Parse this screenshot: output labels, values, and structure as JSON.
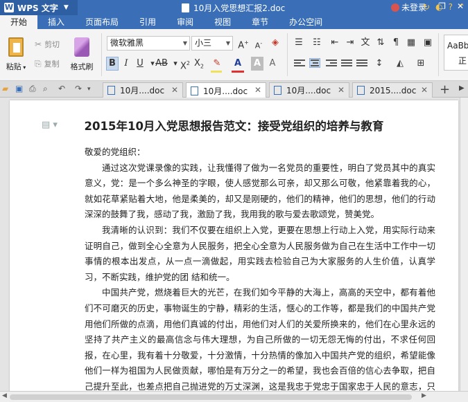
{
  "app": {
    "name": "WPS 文字",
    "doc_title": "10月入党思想汇报2.doc",
    "login_label": "未登录"
  },
  "menu": [
    "开始",
    "插入",
    "页面布局",
    "引用",
    "审阅",
    "视图",
    "章节",
    "办公空间"
  ],
  "ribbon": {
    "paste": "粘贴",
    "cut": "剪切",
    "copy": "复制",
    "format_painter": "格式刷",
    "font_name": "微软雅黑",
    "font_size": "小三",
    "style_preview_top": "AaBb",
    "style_preview_bottom": "正"
  },
  "tabs": [
    "10月....doc",
    "10月....doc",
    "10月....doc",
    "2015....doc"
  ],
  "document": {
    "heading": "2015年10月入党思想报告范文：接受党组织的培养与教育",
    "salutation": "敬爱的党组织：",
    "paragraphs": [
      "通过这次党课录像的实践，让我懂得了做为一名党员的重要性，明白了党员其中的真实意义，党：是一个多么神圣的字眼，使人感觉那么可亲，却又那么可敬，他紧靠着我的心，就如花草紧贴着大地，他是柔美的，却又是刚硬的，他们的精神，他们的思想，他们的行动深深的鼓舞了我，感动了我，激励了我，我用我的歌与爱去歌颂党，赞美党。",
      "我清晰的认识到：我们不仅要在组织上入党，更要在思想上行动上入党，用实际行动来证明自己，做到全心全意为人民服务，把全心全意为人民服务做为自己在生活中工作中一切事情的根本出发点，从一点一滴做起，用实践去检验自己为大家服务的人生价值，认真学习，不断实践，维护党的团 结和统一。",
      "中国共产党，燃烧着巨大的光芒，在我们如今平静的大海上，高高的天空中，都有着他们不可磨灭的历史，事物诞生的宁静，精彩的生活，惬心的工作等，都是我们的中国共产党用他们所做的点滴，用他们真诚的付出，用他们对人们的关爱所换来的，他们在心里永远的坚持了共产主义的最高信念与伟大理想，为自己所做的一切无怨无悔的付出，不求任何回报，在心里，我有着十分敬爱，十分激情，十分热情的像加入中国共产党的组织，希望能像他们一样为祖国为人民做贡献，哪怕是有万分之一的希望，我也会百倍的信心去争取，把自己提升至此，也差点把自己抛进党的万丈深渊，这是我忠于党忠于国家忠于人民的意志，只要生"
    ]
  }
}
